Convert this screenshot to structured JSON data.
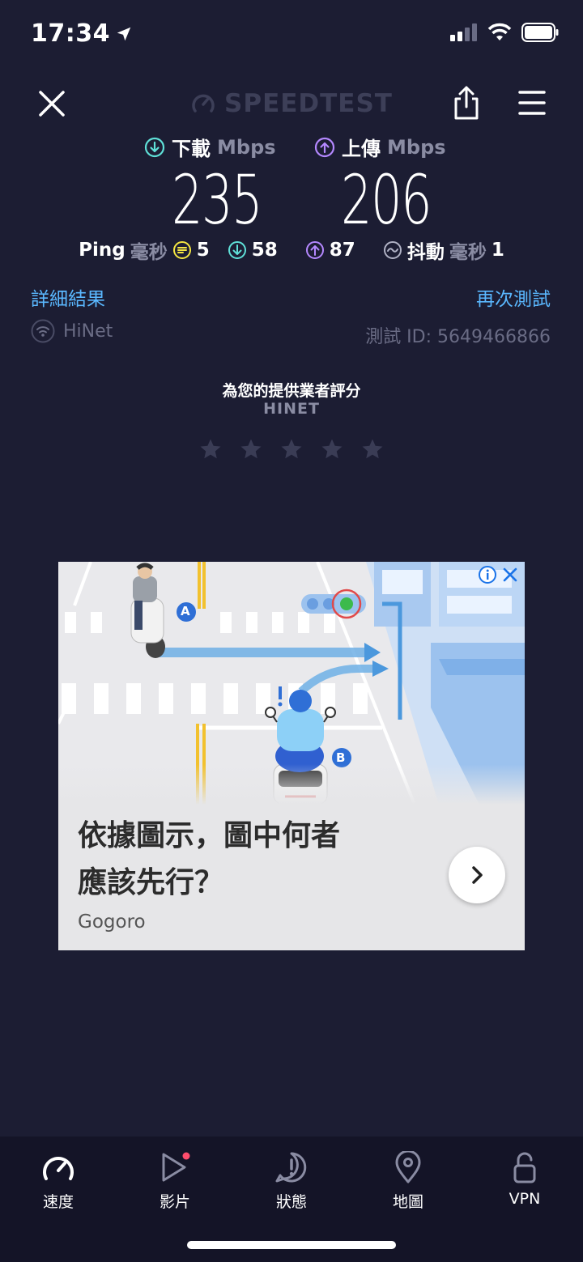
{
  "status_bar": {
    "time": "17:34"
  },
  "header": {
    "brand": "SPEEDTEST"
  },
  "download": {
    "label": "下載",
    "unit": "Mbps",
    "value": "235"
  },
  "upload": {
    "label": "上傳",
    "unit": "Mbps",
    "value": "206"
  },
  "ping": {
    "label": "Ping",
    "unit": "毫秒",
    "idle": "5",
    "download": "58",
    "upload": "87",
    "jitter_label": "抖動",
    "jitter_unit": "毫秒",
    "jitter": "1"
  },
  "links": {
    "details": "詳細結果",
    "retest": "再次測試"
  },
  "provider": {
    "name": "HiNet",
    "test_id": "測試 ID: 5649466866"
  },
  "rating": {
    "title": "為您的提供業者評分",
    "provider": "HINET",
    "stars": 5,
    "selected": 0
  },
  "ad": {
    "headline_line1": "依據圖示，圖中何者",
    "headline_line2": "應該先行？",
    "advertiser": "Gogoro",
    "label_a": "A",
    "label_b": "B"
  },
  "nav": [
    {
      "label": "速度",
      "icon": "speed-gauge-icon"
    },
    {
      "label": "影片",
      "icon": "play-icon"
    },
    {
      "label": "狀態",
      "icon": "alert-icon"
    },
    {
      "label": "地圖",
      "icon": "map-pin-icon"
    },
    {
      "label": "VPN",
      "icon": "lock-icon"
    }
  ],
  "colors": {
    "background": "#1c1d33",
    "download_accent": "#5fe0d8",
    "upload_accent": "#b488ff",
    "idle_accent": "#f5e642",
    "link": "#5ab8ff",
    "notification_dot": "#ff4d6d"
  }
}
